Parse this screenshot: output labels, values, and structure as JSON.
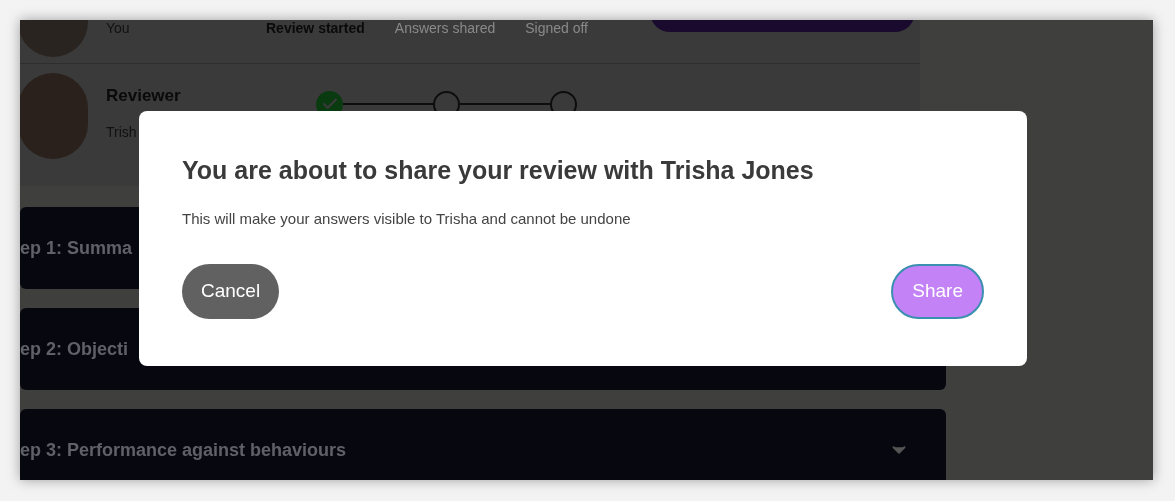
{
  "owner_row": {
    "name": "You",
    "stages": [
      {
        "label": "Review started",
        "selected": true
      },
      {
        "label": "Answers shared",
        "selected": false
      },
      {
        "label": "Signed off",
        "selected": false
      }
    ]
  },
  "reviewer_row": {
    "role": "Reviewer",
    "name": "Trish",
    "steps": [
      {
        "done": true
      },
      {
        "done": false
      },
      {
        "done": false
      }
    ]
  },
  "sections": [
    {
      "title": "ep 1: Summa",
      "expanded": false
    },
    {
      "title": "ep 2: Objecti",
      "expanded": false
    },
    {
      "title": "ep 3: Performance against behaviours",
      "expanded": false
    }
  ],
  "dialog": {
    "title": "You are about to share your review with Trisha Jones",
    "message": "This will make your answers visible to Trisha and cannot be undone",
    "buttons": [
      {
        "label": "Cancel",
        "kind": "secondary"
      },
      {
        "label": "Share",
        "kind": "primary"
      }
    ]
  }
}
